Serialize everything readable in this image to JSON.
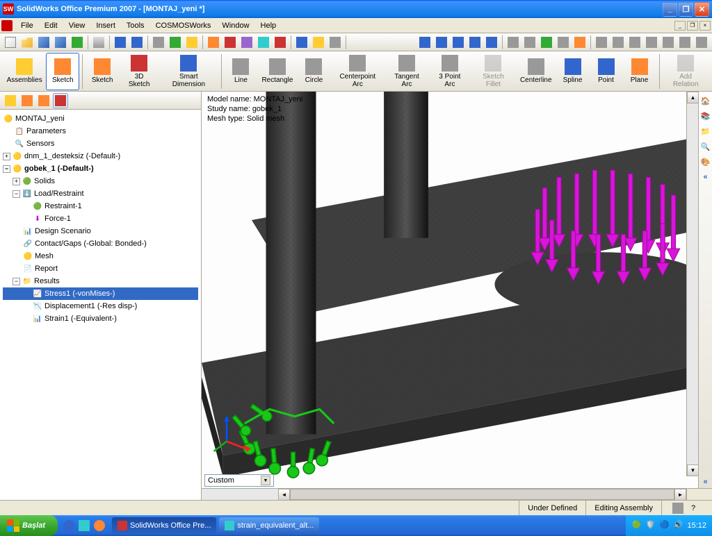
{
  "title": "SolidWorks Office Premium 2007 - [MONTAJ_yeni *]",
  "menus": [
    "File",
    "Edit",
    "View",
    "Insert",
    "Tools",
    "COSMOSWorks",
    "Window",
    "Help"
  ],
  "ribbon": {
    "assemblies": "Assemblies",
    "sketch": "Sketch",
    "sketch2": "Sketch",
    "sketch3d": "3D Sketch",
    "smartdim": "Smart\nDimension",
    "line": "Line",
    "rectangle": "Rectangle",
    "circle": "Circle",
    "centerarc": "Centerpoint\nArc",
    "tangentarc": "Tangent\nArc",
    "threept": "3 Point Arc",
    "sketchfillet": "Sketch\nFillet",
    "centerline": "Centerline",
    "spline": "Spline",
    "point": "Point",
    "plane": "Plane",
    "addrel": "Add\nRelation"
  },
  "tree": {
    "root": "MONTAJ_yeni",
    "params": "Parameters",
    "sensors": "Sensors",
    "dnm": "dnm_1_desteksiz (-Default-)",
    "gobek": "gobek_1 (-Default-)",
    "solids": "Solids",
    "loadrest": "Load/Restraint",
    "restraint1": "Restraint-1",
    "force1": "Force-1",
    "designscen": "Design Scenario",
    "contact": "Contact/Gaps (-Global: Bonded-)",
    "mesh": "Mesh",
    "report": "Report",
    "results": "Results",
    "stress1": "Stress1 (-vonMises-)",
    "disp1": "Displacement1 (-Res disp-)",
    "strain1": "Strain1 (-Equivalent-)"
  },
  "overlay": {
    "l1": "Model name: MONTAJ_yeni",
    "l2": "Study name: gobek_1",
    "l3": "Mesh type: Solid mesh"
  },
  "view_mode": "Custom",
  "status": {
    "underdef": "Under Defined",
    "editing": "Editing Assembly"
  },
  "taskbar": {
    "start": "Başlat",
    "t1": "SolidWorks Office Pre...",
    "t2": "strain_equivalent_alt...",
    "clock": "15:12"
  }
}
